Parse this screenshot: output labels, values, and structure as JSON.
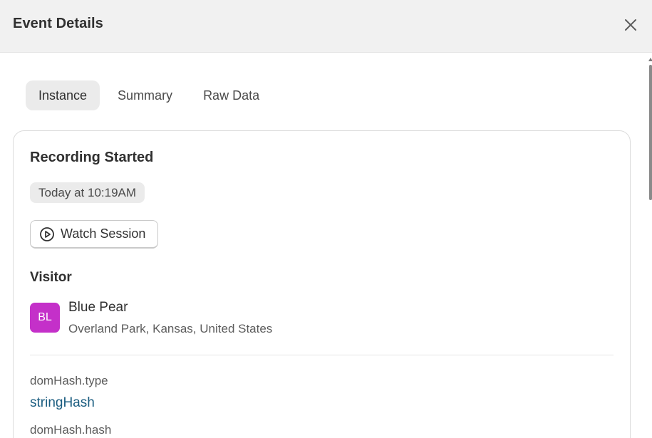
{
  "header": {
    "title": "Event Details",
    "close_icon": "close-icon"
  },
  "tabs": [
    {
      "label": "Instance",
      "active": true
    },
    {
      "label": "Summary",
      "active": false
    },
    {
      "label": "Raw Data",
      "active": false
    }
  ],
  "event": {
    "title": "Recording Started",
    "time": "Today at 10:19AM",
    "watch_button": {
      "label": "Watch Session",
      "icon": "play-circle-icon"
    }
  },
  "visitor": {
    "heading": "Visitor",
    "initials": "BL",
    "avatar_color": "#c430c9",
    "name": "Blue Pear",
    "location": "Overland Park, Kansas, United States"
  },
  "properties": [
    {
      "key": "domHash.type",
      "value": "stringHash"
    },
    {
      "key": "domHash.hash",
      "value": ""
    }
  ],
  "colors": {
    "header_bg": "#f1f1f1",
    "link_value": "#1b5d80",
    "active_tab_bg": "#ebebeb"
  }
}
